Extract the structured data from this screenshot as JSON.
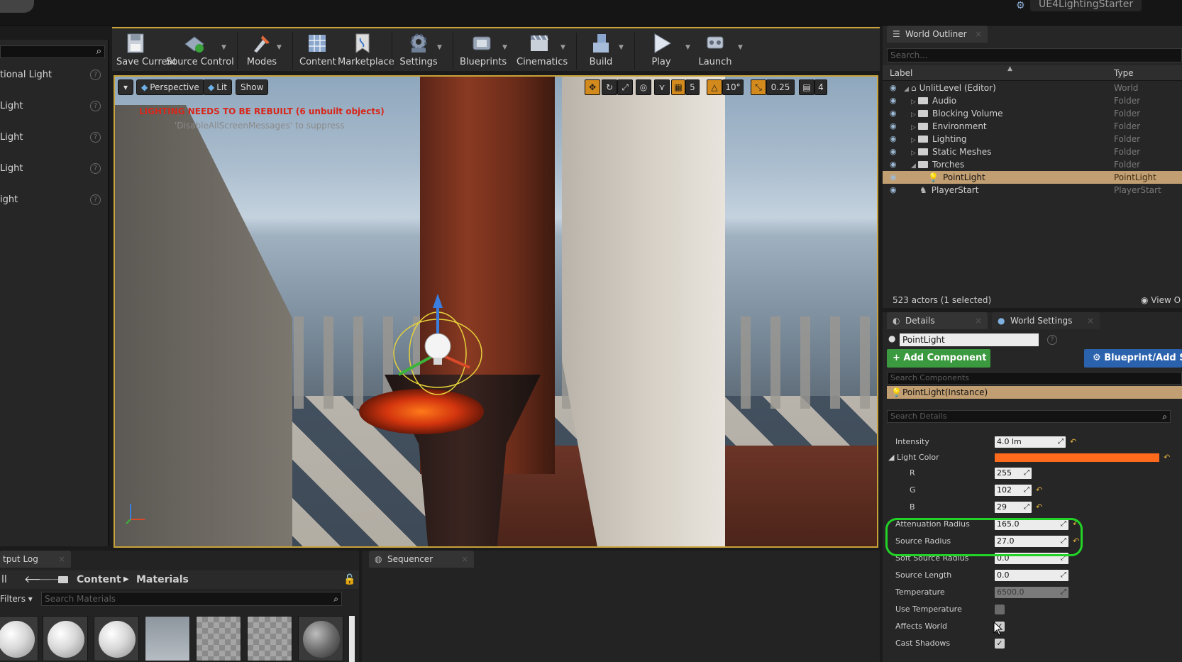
{
  "window": {
    "project_name": "UE4LightingStarter"
  },
  "place_panel": {
    "items": [
      "tional Light",
      "Light",
      "Light",
      "Light",
      "ight"
    ]
  },
  "toolbar": {
    "buttons": [
      {
        "label": "Save Current",
        "icon": "save-icon"
      },
      {
        "label": "Source Control",
        "icon": "source-control-icon"
      },
      {
        "label": "Modes",
        "icon": "modes-icon"
      },
      {
        "label": "Content",
        "icon": "content-icon"
      },
      {
        "label": "Marketplace",
        "icon": "marketplace-icon"
      },
      {
        "label": "Settings",
        "icon": "settings-icon"
      },
      {
        "label": "Blueprints",
        "icon": "blueprints-icon"
      },
      {
        "label": "Cinematics",
        "icon": "cinematics-icon"
      },
      {
        "label": "Build",
        "icon": "build-icon"
      },
      {
        "label": "Play",
        "icon": "play-icon"
      },
      {
        "label": "Launch",
        "icon": "launch-icon"
      }
    ]
  },
  "viewport": {
    "perspective_label": "Perspective",
    "lit_label": "Lit",
    "show_label": "Show",
    "grid_snap": "5",
    "rotation_snap": "10°",
    "scale_snap": "0.25",
    "camera_speed": "4",
    "warning": "LIGHTING NEEDS TO BE REBUILT (6 unbuilt objects)",
    "suppress_hint": "'DisableAllScreenMessages' to suppress",
    "accent_color": "#c8a23a",
    "warning_color": "#d8261a"
  },
  "outliner": {
    "tab_label": "World Outliner",
    "search_placeholder": "Search...",
    "col_label": "Label",
    "col_type": "Type",
    "rows": [
      {
        "name": "UnlitLevel (Editor)",
        "type": "World"
      },
      {
        "name": "Audio",
        "type": "Folder"
      },
      {
        "name": "Blocking Volume",
        "type": "Folder"
      },
      {
        "name": "Environment",
        "type": "Folder"
      },
      {
        "name": "Lighting",
        "type": "Folder"
      },
      {
        "name": "Static Meshes",
        "type": "Folder"
      },
      {
        "name": "Torches",
        "type": "Folder"
      },
      {
        "name": "PointLight",
        "type": "PointLight"
      },
      {
        "name": "PlayerStart",
        "type": "PlayerStart"
      }
    ],
    "actor_count": "523 actors (1 selected)",
    "view_options": "View O"
  },
  "details": {
    "tab_details": "Details",
    "tab_world_settings": "World Settings",
    "actor_name": "PointLight",
    "add_component": "Add Component",
    "blueprint_add": "Blueprint/Add S",
    "search_components_placeholder": "Search Components",
    "component_instance": "PointLight(Instance)",
    "search_details_placeholder": "Search Details",
    "properties": {
      "intensity": {
        "label": "Intensity",
        "value": "4.0 lm"
      },
      "light_color": {
        "label": "Light Color",
        "color": "#ff6a1d"
      },
      "r": {
        "label": "R",
        "value": "255"
      },
      "g": {
        "label": "G",
        "value": "102"
      },
      "b": {
        "label": "B",
        "value": "29"
      },
      "attenuation_radius": {
        "label": "Attenuation Radius",
        "value": "165.0"
      },
      "source_radius": {
        "label": "Source Radius",
        "value": "27.0"
      },
      "soft_source_radius": {
        "label": "Soft Source Radius",
        "value": "0.0"
      },
      "source_length": {
        "label": "Source Length",
        "value": "0.0"
      },
      "temperature": {
        "label": "Temperature",
        "value": "6500.0"
      },
      "use_temperature": {
        "label": "Use Temperature",
        "checked": false
      },
      "affects_world": {
        "label": "Affects World",
        "checked": true
      },
      "cast_shadows": {
        "label": "Cast Shadows",
        "checked": true
      }
    },
    "highlight_color": "#22d226"
  },
  "bottom": {
    "output_log_tab": "tput Log",
    "sequencer_tab": "Sequencer",
    "path_all": "ll",
    "path_content": "Content",
    "path_materials": "Materials",
    "filters_label": "Filters",
    "search_materials_placeholder": "Search Materials"
  }
}
